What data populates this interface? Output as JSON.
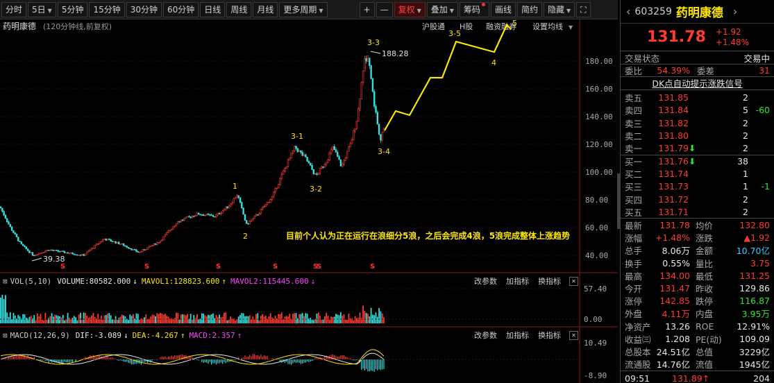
{
  "toolbar": {
    "tabs": [
      "分时",
      "5日",
      "5分钟",
      "15分钟",
      "30分钟",
      "60分钟",
      "日线",
      "周线",
      "月线",
      "更多周期"
    ],
    "plus": "+",
    "minus": "—",
    "fuquan": "复权",
    "diejia": "叠加",
    "chouma": "筹码",
    "huaxian": "画线",
    "jianyue": "简约",
    "yincang": "隐藏"
  },
  "chart": {
    "stock_name": "药明康德",
    "subtitle": "(120分钟线,前复权)",
    "links": [
      "沪股通",
      "H股",
      "融资融券",
      "设置均线"
    ],
    "y_ticks": [
      "180.00",
      "160.00",
      "140.00",
      "120.00",
      "100.00",
      "80.00",
      "60.00",
      "40.00"
    ],
    "high_label": "188.28",
    "low_label": "39.38",
    "wave_labels": [
      "1",
      "2",
      "3-1",
      "3-2",
      "3-3",
      "3-4",
      "3-5",
      "4",
      "5"
    ],
    "annotation": "目前个人认为正在运行在浪细分5浪，之后会完成4浪，5浪完成整体上涨趋势",
    "s_mark": "S"
  },
  "vol": {
    "label": "VOL(5,10)",
    "volume": "VOLUME:80582.000",
    "mavol1": "MAVOL1:128823.600",
    "mavol2": "MAVOL2:115445.600",
    "buttons": [
      "改参数",
      "加指标",
      "换指标"
    ],
    "y_ticks": [
      "57.40",
      "0.00"
    ]
  },
  "macd": {
    "label": "MACD(12,26,9)",
    "dif": "DIF:-3.089",
    "dea": "DEA:-4.267",
    "macd": "MACD:2.357",
    "buttons": [
      "改参数",
      "加指标",
      "换指标"
    ],
    "y_ticks": [
      "10.49",
      "-8.90"
    ]
  },
  "sidebar": {
    "code": "603259",
    "name": "药明康德",
    "price": "131.78",
    "change": "+1.92",
    "change_pct": "+1.48%",
    "trade_status_label": "交易状态",
    "trade_status": "交易中",
    "weibi_label": "委比",
    "weibi": "54.39%",
    "weicha_label": "委差",
    "weicha": "31",
    "dk_link": "DK点自动提示涨跌信号",
    "asks": [
      {
        "label": "卖五",
        "price": "131.85",
        "vol": "2",
        "chg": ""
      },
      {
        "label": "卖四",
        "price": "131.84",
        "vol": "5",
        "chg": "-60"
      },
      {
        "label": "卖三",
        "price": "131.82",
        "vol": "2",
        "chg": ""
      },
      {
        "label": "卖二",
        "price": "131.80",
        "vol": "2",
        "chg": ""
      },
      {
        "label": "卖一",
        "price": "131.79",
        "vol": "2",
        "chg": ""
      }
    ],
    "bids": [
      {
        "label": "买一",
        "price": "131.76",
        "vol": "38",
        "chg": ""
      },
      {
        "label": "买二",
        "price": "131.74",
        "vol": "1",
        "chg": ""
      },
      {
        "label": "买三",
        "price": "131.73",
        "vol": "1",
        "chg": "-1"
      },
      {
        "label": "买四",
        "price": "131.72",
        "vol": "2",
        "chg": ""
      },
      {
        "label": "买五",
        "price": "131.71",
        "vol": "2",
        "chg": ""
      }
    ],
    "stats": [
      {
        "l1": "最新",
        "v1": "131.78",
        "c1": "red",
        "l2": "均价",
        "v2": "132.80",
        "c2": "red"
      },
      {
        "l1": "涨幅",
        "v1": "+1.48%",
        "c1": "red",
        "l2": "涨跌",
        "v2": "▲1.92",
        "c2": "red"
      },
      {
        "l1": "总手",
        "v1": "8.06万",
        "c1": "white",
        "l2": "金额",
        "v2": "10.70亿",
        "c2": "cyan"
      },
      {
        "l1": "换手",
        "v1": "0.55%",
        "c1": "white",
        "l2": "量比",
        "v2": "3.75",
        "c2": "red"
      },
      {
        "l1": "最高",
        "v1": "134.00",
        "c1": "red",
        "l2": "最低",
        "v2": "131.25",
        "c2": "red"
      },
      {
        "l1": "今开",
        "v1": "131.47",
        "c1": "red",
        "l2": "昨收",
        "v2": "129.86",
        "c2": "white"
      },
      {
        "l1": "涨停",
        "v1": "142.85",
        "c1": "red",
        "l2": "跌停",
        "v2": "116.87",
        "c2": "green"
      },
      {
        "l1": "外盘",
        "v1": "4.11万",
        "c1": "red",
        "l2": "内盘",
        "v2": "3.95万",
        "c2": "green"
      },
      {
        "l1": "净资产",
        "v1": "13.26",
        "c1": "white",
        "l2": "ROE",
        "v2": "12.91%",
        "c2": "white"
      },
      {
        "l1": "收益㈢",
        "v1": "1.208",
        "c1": "white",
        "l2": "PE(动)",
        "v2": "109.09",
        "c2": "white"
      },
      {
        "l1": "总股本",
        "v1": "24.51亿",
        "c1": "white",
        "l2": "总值",
        "v2": "3229亿",
        "c2": "white"
      },
      {
        "l1": "流通股",
        "v1": "14.76亿",
        "c1": "white",
        "l2": "流值",
        "v2": "1945亿",
        "c2": "white"
      }
    ],
    "tick_time": "09:51",
    "tick_price": "131.89",
    "tick_vol": "204"
  }
}
